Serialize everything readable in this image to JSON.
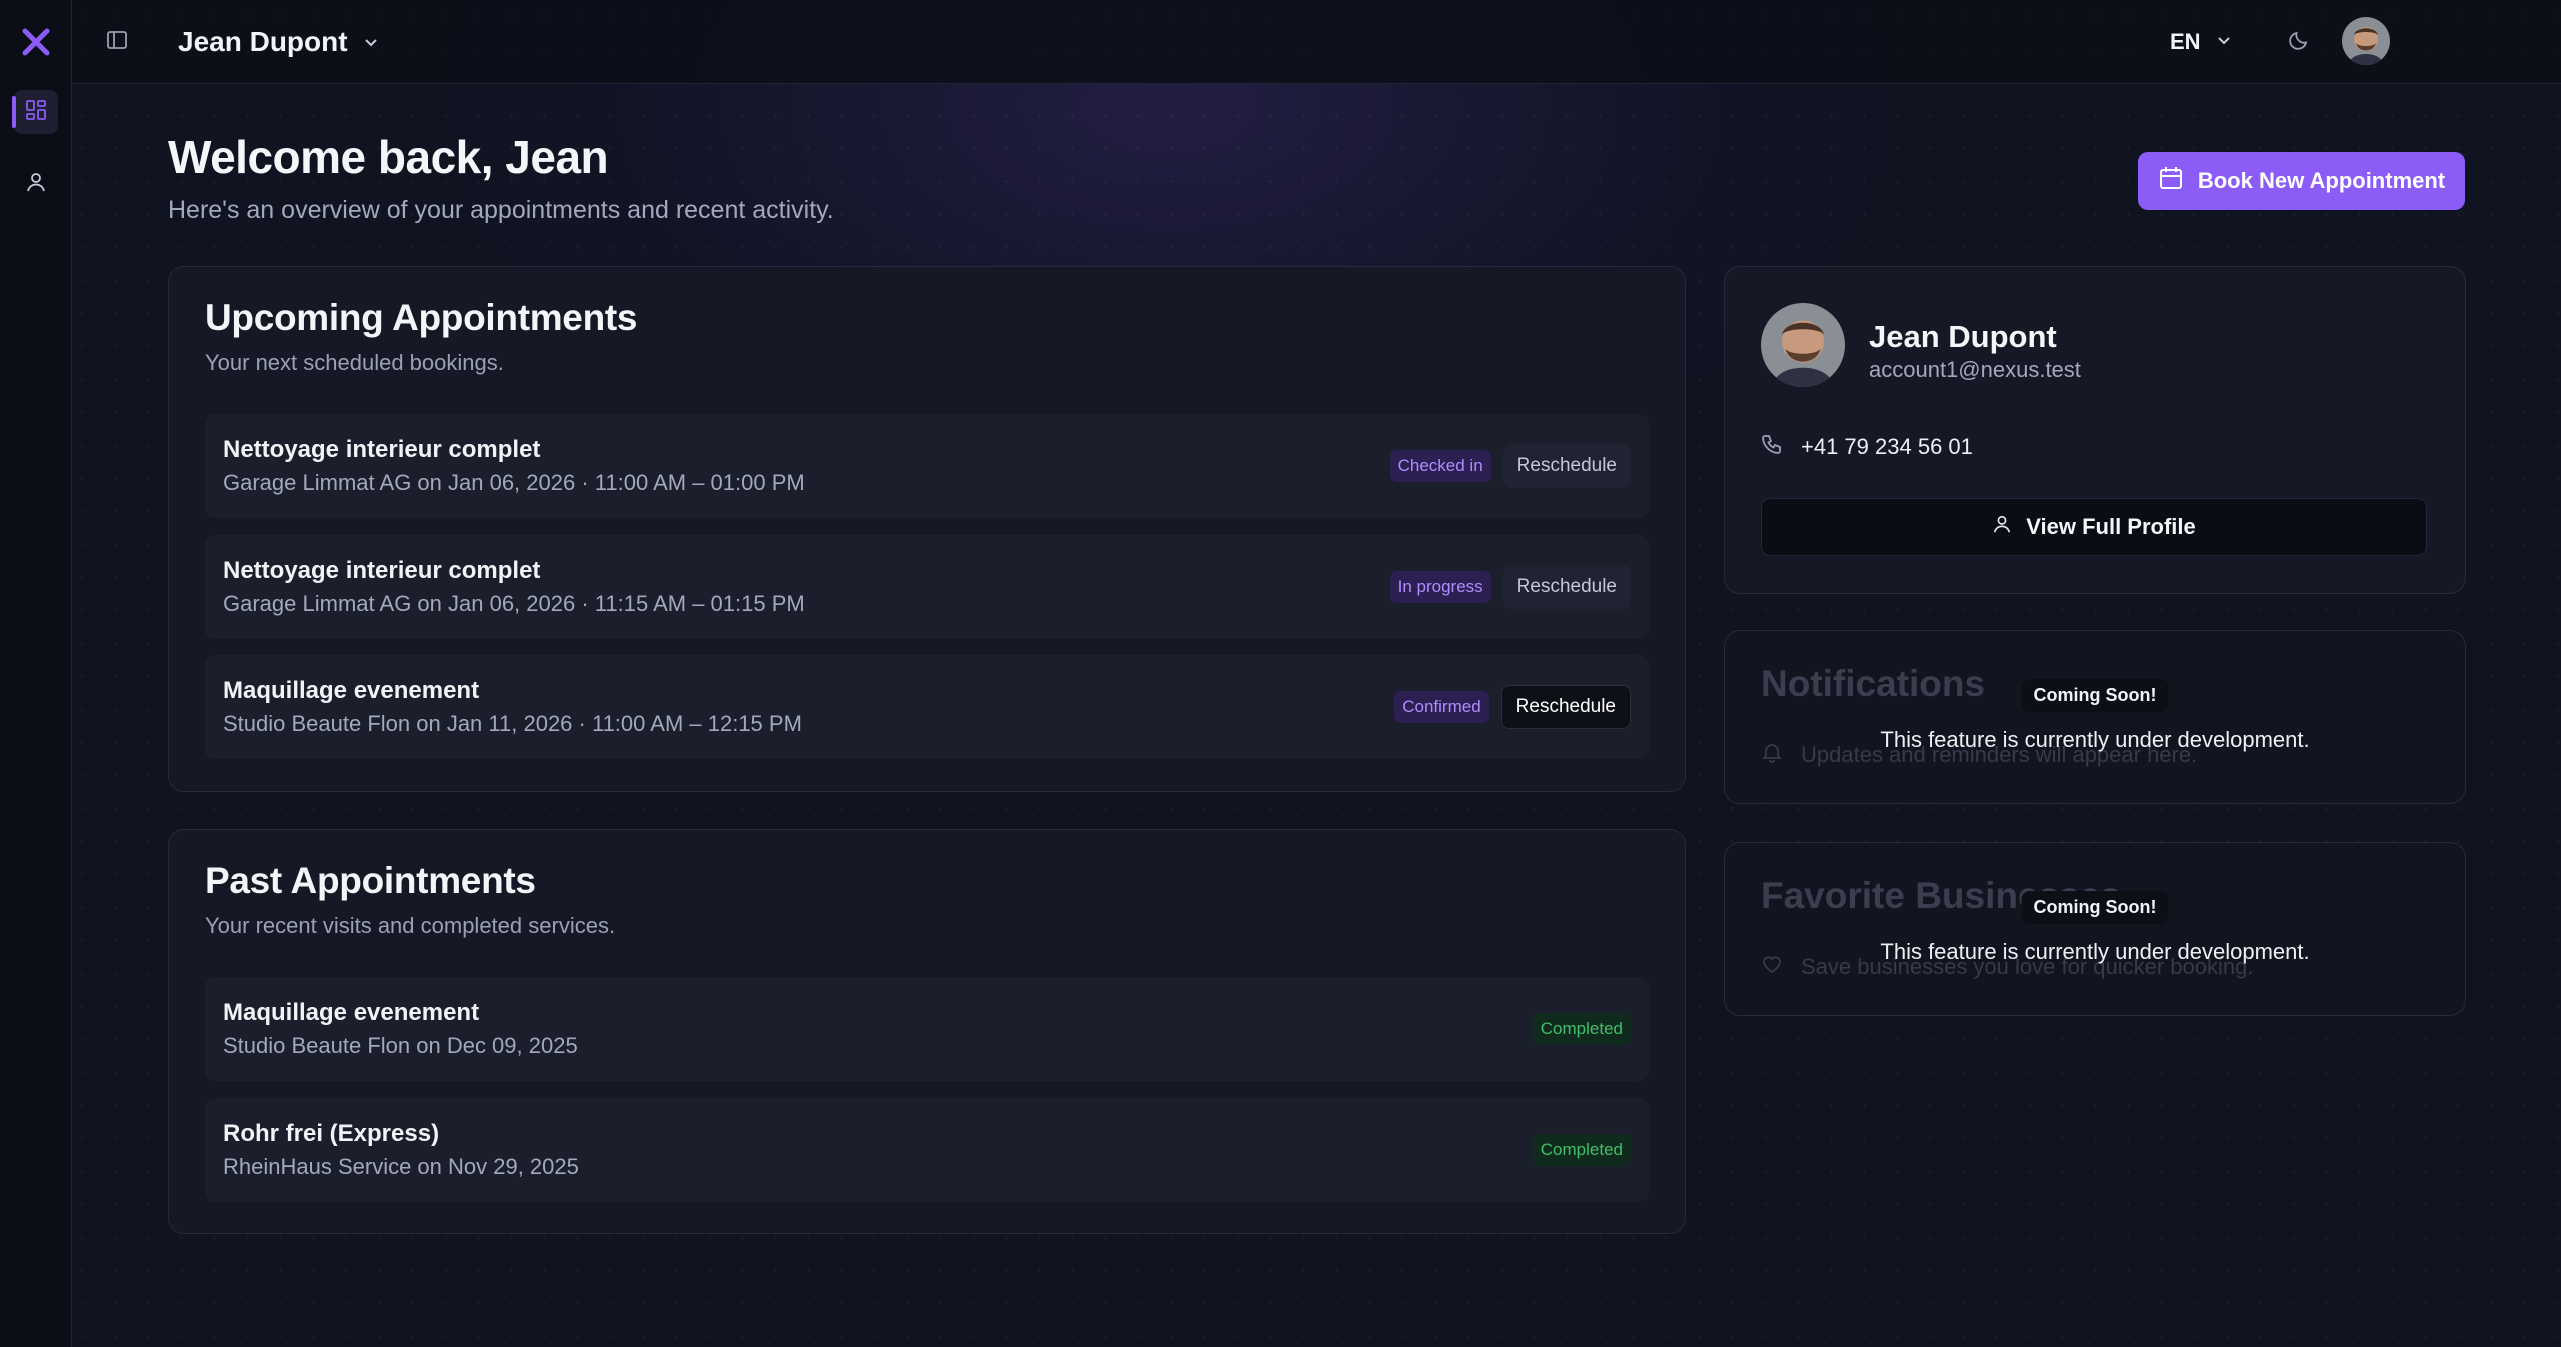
{
  "topbar": {
    "current_user": "Jean Dupont",
    "language": "EN"
  },
  "header": {
    "title": "Welcome back, Jean",
    "subtitle": "Here's an overview of your appointments and recent activity.",
    "book_button": "Book New Appointment"
  },
  "upcoming": {
    "title": "Upcoming Appointments",
    "subtitle": "Your next scheduled bookings.",
    "items": [
      {
        "service": "Nettoyage interieur complet",
        "meta": "Garage Limmat AG on Jan 06, 2026 · 11:00 AM – 01:00 PM",
        "status": "Checked in",
        "action": "Reschedule"
      },
      {
        "service": "Nettoyage interieur complet",
        "meta": "Garage Limmat AG on Jan 06, 2026 · 11:15 AM – 01:15 PM",
        "status": "In progress",
        "action": "Reschedule"
      },
      {
        "service": "Maquillage evenement",
        "meta": "Studio Beaute Flon on Jan 11, 2026 · 11:00 AM – 12:15 PM",
        "status": "Confirmed",
        "action": "Reschedule"
      }
    ]
  },
  "past": {
    "title": "Past Appointments",
    "subtitle": "Your recent visits and completed services.",
    "items": [
      {
        "service": "Maquillage evenement",
        "meta": "Studio Beaute Flon on Dec 09, 2025",
        "status": "Completed"
      },
      {
        "service": "Rohr frei (Express)",
        "meta": "RheinHaus Service on Nov 29, 2025",
        "status": "Completed"
      }
    ]
  },
  "profile": {
    "name": "Jean Dupont",
    "email": "account1@nexus.test",
    "phone": "+41 79 234 56 01",
    "view_button": "View Full Profile"
  },
  "notifications": {
    "title": "Notifications",
    "empty_text": "Updates and reminders will appear here.",
    "overlay_badge": "Coming Soon!",
    "overlay_text": "This feature is currently under development."
  },
  "favorites": {
    "title": "Favorite Businesses",
    "empty_text": "Save businesses you love for quicker booking.",
    "overlay_badge": "Coming Soon!",
    "overlay_text": "This feature is currently under development."
  },
  "colors": {
    "accent": "#8b5cf6",
    "background": "#101320",
    "card": "#161925",
    "status_purple": "#b08cff",
    "status_green": "#3fbf6a"
  },
  "icons": [
    "logo-x-icon",
    "dashboard-icon",
    "user-icon",
    "sidebar-toggle-icon",
    "chevron-down-icon",
    "moon-icon",
    "calendar-icon",
    "phone-icon",
    "bell-icon",
    "heart-icon"
  ]
}
